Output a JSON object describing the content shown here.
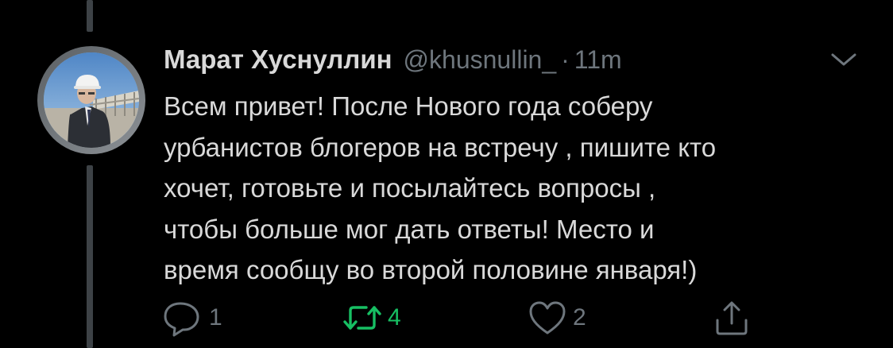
{
  "tweet": {
    "author_name": "Марат Хуснуллин",
    "handle": "@khusnullin_",
    "separator": "·",
    "time": "11m",
    "text_lines": [
      "Всем привет! После Нового года соберу",
      "урбанистов блогеров на встречу , пишите кто",
      "хочет, готовьте и посылайтесь вопросы ,",
      "чтобы больше мог дать ответы! Место и",
      "время сообщу во второй половине января!)"
    ]
  },
  "actions": {
    "reply_count": "1",
    "retweet_count": "4",
    "like_count": "2"
  },
  "icons": {
    "reply": "reply-icon",
    "retweet": "retweet-icon",
    "like": "heart-icon",
    "share": "share-icon",
    "menu": "chevron-down-icon"
  },
  "colors": {
    "background": "#000000",
    "text": "#d9d9d9",
    "muted": "#6e767d",
    "retweeted": "#17bf63",
    "thread_line": "#3d4246"
  }
}
